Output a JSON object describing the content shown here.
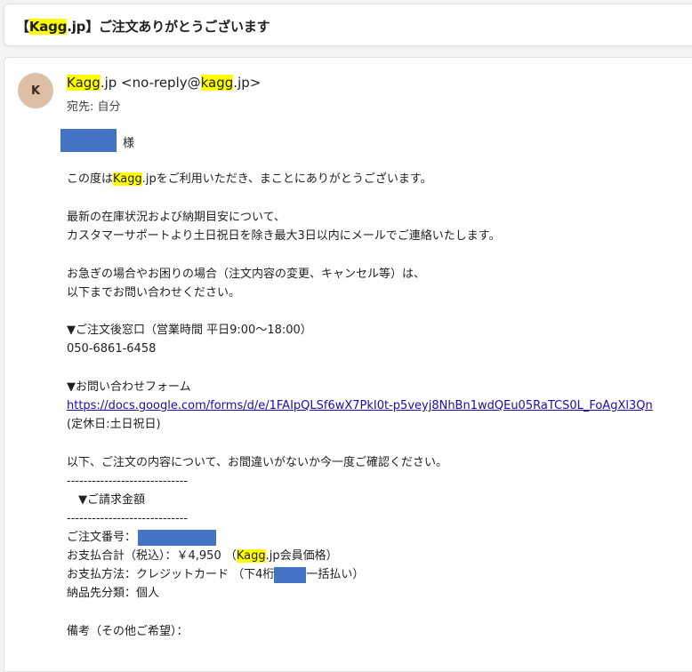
{
  "subject": {
    "pre": "【",
    "brand": "Kagg",
    "post": ".jp】ご注文ありがとうございます"
  },
  "avatar": {
    "letter": "K",
    "color": "#ddbfa8"
  },
  "sender": {
    "brand": "Kagg",
    "mid": ".jp <no-reply@",
    "brand2": "kagg",
    "post": ".jp>"
  },
  "to": {
    "label": "宛先:",
    "value": "自分"
  },
  "body": {
    "sama": "様",
    "l1_pre": "この度は",
    "l1_brand": "Kagg",
    "l1_post": ".jpをご利用いただき、まことにありがとうございます。",
    "l2": "最新の在庫状況および納期目安について、",
    "l3": "カスタマーサポートより土日祝日を除き最大3日以内にメールでご連絡いたします。",
    "l4": "お急ぎの場合やお困りの場合（注文内容の変更、キャンセル等）は、",
    "l5": "以下までお問い合わせください。",
    "l6": "▼ご注文後窓口（営業時間 平日9:00〜18:00）",
    "l7": "050-6861-6458",
    "l8": "▼お問い合わせフォーム",
    "link": "https://docs.google.com/forms/d/e/1FAIpQLSf6wX7PkI0t-p5veyj8NhBn1wdQEu05RaTCS0L_FoAgXl3Qn",
    "l9": "(定休日:土日祝日)",
    "l10": "以下、ご注文の内容について、お間違いがないか今一度ご確認ください。",
    "dash1": "-----------------------------",
    "l11": "　▼ご請求金額",
    "dash2": "-----------------------------",
    "l12": "ご注文番号：",
    "l13_pre": "お支払合計（税込）：￥4,950 （",
    "l13_brand": "Kagg",
    "l13_post": ".jp会員価格）",
    "l14_pre": "お支払方法：クレジットカード （下4桁",
    "l14_post": "一括払い）",
    "l15": "納品先分類：個人",
    "l16": "備考（その他ご希望）："
  },
  "colors": {
    "highlight": "#ffff00",
    "redaction": "#4472c4",
    "link": "#1a0dab"
  }
}
